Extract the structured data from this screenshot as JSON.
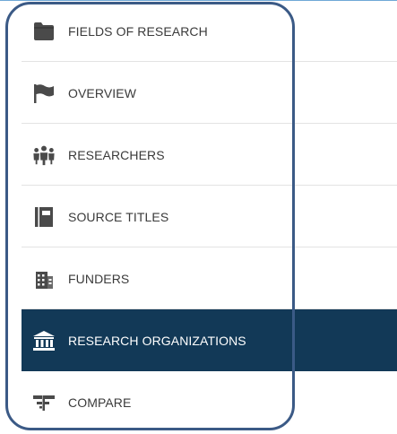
{
  "menu": {
    "items": [
      {
        "label": "FIELDS OF RESEARCH",
        "icon": "folder-icon",
        "active": false
      },
      {
        "label": "OVERVIEW",
        "icon": "flag-icon",
        "active": false
      },
      {
        "label": "RESEARCHERS",
        "icon": "people-group-icon",
        "active": false
      },
      {
        "label": "SOURCE TITLES",
        "icon": "book-icon",
        "active": false
      },
      {
        "label": "FUNDERS",
        "icon": "building-icon",
        "active": false
      },
      {
        "label": "RESEARCH ORGANIZATIONS",
        "icon": "institution-icon",
        "active": true
      },
      {
        "label": "COMPARE",
        "icon": "compare-icon",
        "active": false
      }
    ]
  },
  "colors": {
    "active_background": "#123957",
    "active_text": "#ffffff",
    "text": "#3a3a3a",
    "icon": "#4a4a4a",
    "highlight_outline": "#3b5a86"
  }
}
